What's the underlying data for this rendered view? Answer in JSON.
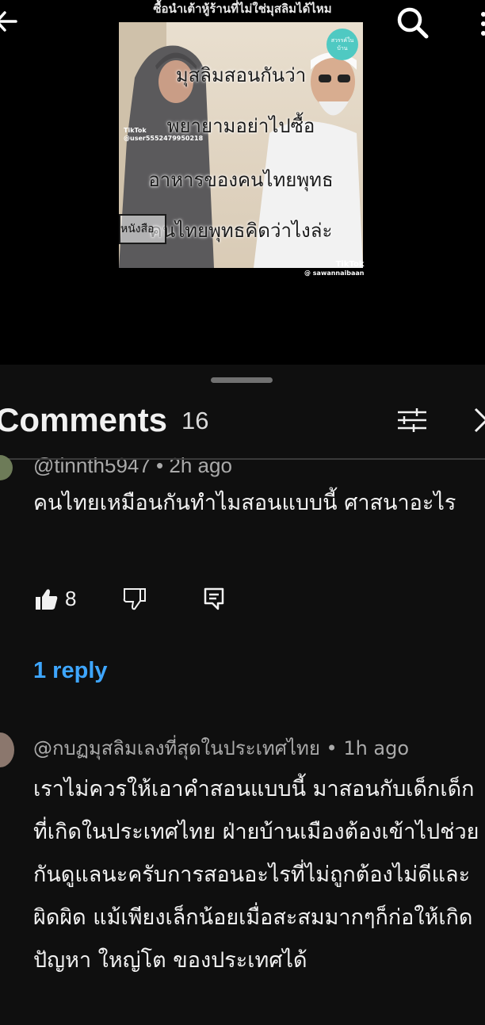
{
  "video": {
    "caption": "ซื้อนำเต้าหู้ร้านที่ไม่ใช่มุสลิมได้ไหม",
    "overlay_lines": [
      "มุสลิมสอนกันว่า",
      "พยายามอย่าไปซื้อ",
      "อาหารของคนไทยพุทธ",
      "คนไทยพุทธคิดว่าไงล่ะ"
    ],
    "badge_text": "สวรรค์ในบ้าน",
    "tiktok_left_label": "TikTok",
    "tiktok_left_user": "@user5552479950218",
    "tiktok_right_label": "TikTok",
    "tiktok_right_user": "@ sawannaibaan",
    "side_box_text": "หนังสือ"
  },
  "header": {
    "title": "Comments",
    "count": "16"
  },
  "comments": [
    {
      "author": "@tinnth5947",
      "time": "2h ago",
      "meta": "@tinnth5947 • 2h ago",
      "text": "คนไทยเหมือนกันทำไมสอนแบบนี้ ศาสนาอะไร",
      "likes": "8",
      "replies_label": "1 reply"
    },
    {
      "author": "@กบฏมุสลิมเลงที่สุดในประเทศไทย",
      "time": "1h ago",
      "meta": "@กบฏมุสลิมเลงที่สุดในประเทศไทย • 1h ago",
      "text": "เราไม่ควรให้เอาคำสอนแบบนี้  มาสอนกับเด็กเด็กที่เกิดในประเทศไทย ฝ่ายบ้านเมืองต้องเข้าไปช่วยกันดูแลนะครับการสอนอะไรที่ไม่ถูกต้องไม่ดีและผิดผิด แม้เพียงเล็กน้อยเมื่อสะสมมากๆก็ก่อให้เกิดปัญหา ใหญ่โต ของประเทศได้"
    }
  ],
  "colors": {
    "background": "#0f0f0f",
    "link": "#3ea6ff",
    "meta": "#aaaaaa"
  },
  "icons": [
    "back-arrow-icon",
    "search-icon",
    "more-vert-icon",
    "filter-icon",
    "close-icon",
    "like-icon",
    "dislike-icon",
    "reply-icon"
  ]
}
